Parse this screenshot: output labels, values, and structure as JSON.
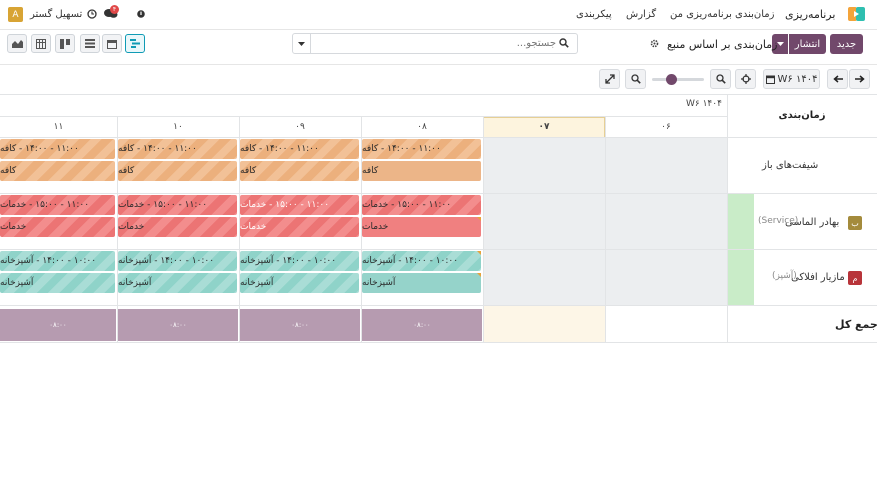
{
  "nav": {
    "app_name": "برنامه‌ریزی",
    "menu": [
      "زمان‌بندی",
      "برنامه‌ریزی من",
      "گزارش",
      "پیکربندی"
    ],
    "user_name": "تسهیل گستر",
    "user_initial": "A",
    "chat_badge": "۴"
  },
  "control": {
    "new_label": "جدید",
    "publish_label": "انتشار",
    "view_title": "زمان‌بندی بر اساس منبع",
    "search_placeholder": "جستجو..."
  },
  "toolbar": {
    "period_label": "W۶ ۱۴۰۴"
  },
  "gantt": {
    "corner_label": "زمان‌بندی",
    "week_label": "W۶ ۱۴۰۴",
    "columns": [
      "۰۶",
      "۰۷",
      "۰۸",
      "۰۹",
      "۱۰",
      "۱۱"
    ],
    "today_column": "۰۷",
    "rows": [
      {
        "label": "شیفت‌های باز",
        "role": "",
        "initial": ""
      },
      {
        "label": "بهادر الماسی",
        "role": "(Service)",
        "initial": "ب"
      },
      {
        "label": "مازیار افلاکی",
        "role": "(آشپز)",
        "initial": "م"
      }
    ],
    "shifts": {
      "open_top": "۱۱:۰۰ - ۱۴:۰۰ - کافه",
      "open_bottom": "کافه",
      "service_top": "۱۱:۰۰ - ۱۵:۰۰ - خدمات",
      "service_bottom": "خدمات",
      "kitchen_top": "۱۰:۰۰ - ۱۴:۰۰ - آشپزخانه",
      "kitchen_bottom": "آشپزخانه"
    },
    "total_label": "جمع کل",
    "total_value": "۰۸:۰۰",
    "colors": {
      "accent": "#71486b",
      "open": "#ecb588",
      "service": "#f08080",
      "kitchen": "#95d3ca",
      "today": "#fdf6e7"
    }
  }
}
